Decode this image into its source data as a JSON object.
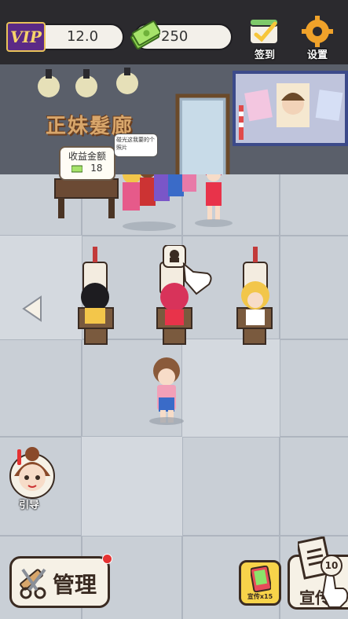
{
  "hud": {
    "vip_label": "VIP",
    "vip_value": "12.0",
    "cash_value": "250",
    "checkin_label": "签到",
    "settings_label": "设置"
  },
  "shop": {
    "sign": "正妹髮廊",
    "income_title": "收益金额",
    "income_amount": "18",
    "customer_speech": "碰光这我要的个照片"
  },
  "bottom": {
    "manage_label": "管理",
    "promo_x15_label": "宣传x15",
    "promo_label": "宣传",
    "promo_count": "10",
    "guide_label": "引导"
  },
  "colors": {
    "topbar": "#2b2a2e",
    "floor": "#c9cfd6",
    "wall": "#5a5f6a",
    "accent_gold": "#f7d34a",
    "vip_purple": "#5b2a86"
  },
  "icons": {
    "cash": "money-bill-icon",
    "checkin": "calendar-check-icon",
    "settings": "gear-icon",
    "manage": "scissors-comb-icon",
    "promo": "flyer-icon",
    "hand": "pointer-hand-icon"
  }
}
